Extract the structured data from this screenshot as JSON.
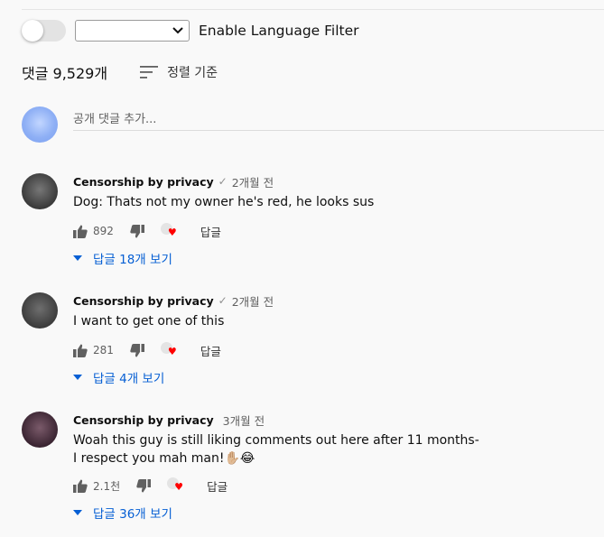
{
  "filter": {
    "label": "Enable Language Filter",
    "selected": ""
  },
  "header": {
    "comment_count": "댓글 9,529개",
    "sort_label": "정렬 기준"
  },
  "add_comment": {
    "placeholder": "공개 댓글 추가..."
  },
  "comments": [
    {
      "author": "Censorship by privacy",
      "verified": "✓",
      "time": "2개월 전",
      "text": [
        "Dog: Thats not my owner he's red, he looks sus"
      ],
      "likes": "892",
      "reply_label": "답글",
      "replies_label": "답글 18개 보기"
    },
    {
      "author": "Censorship by privacy",
      "verified": "✓",
      "time": "2개월 전",
      "text": [
        "I want to get one of this"
      ],
      "likes": "281",
      "reply_label": "답글",
      "replies_label": "답글 4개 보기"
    },
    {
      "author": "Censorship by privacy",
      "verified": "",
      "time": "3개월 전",
      "text": [
        "Woah this guy is still liking comments out here after 11 months-",
        "I respect you mah man!✋🏼😂"
      ],
      "likes": "2.1천",
      "reply_label": "답글",
      "replies_label": "답글 36개 보기"
    }
  ],
  "colors": {
    "link": "#065fd4",
    "heart": "#ff0000"
  }
}
